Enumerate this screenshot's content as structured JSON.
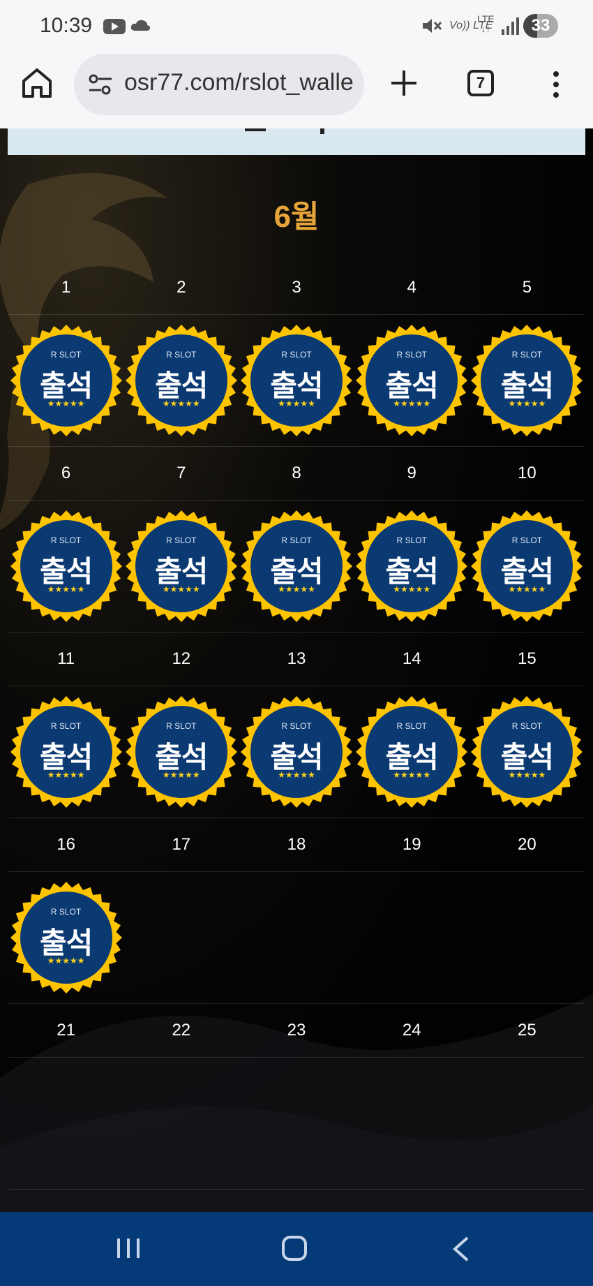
{
  "status_bar": {
    "time": "10:39",
    "icons": [
      "youtube-icon",
      "cloud-icon",
      "mute-icon",
      "volte-icon",
      "lte-icon",
      "signal-icon"
    ],
    "volte": "Vo)) LTE",
    "lte_top": "LTE",
    "lte_bottom": "↓↑",
    "battery": "33"
  },
  "browser": {
    "url": "osr77.com/rslot_walle",
    "tab_count": "7"
  },
  "page": {
    "month_title": "6월",
    "stamp": {
      "brand": "R SLOT",
      "word": "출석",
      "stars": "★★★★★"
    },
    "calendar_rows": [
      {
        "days": [
          "1",
          "2",
          "3",
          "4",
          "5"
        ],
        "stamped": [
          true,
          true,
          true,
          true,
          true
        ]
      },
      {
        "days": [
          "6",
          "7",
          "8",
          "9",
          "10"
        ],
        "stamped": [
          true,
          true,
          true,
          true,
          true
        ]
      },
      {
        "days": [
          "11",
          "12",
          "13",
          "14",
          "15"
        ],
        "stamped": [
          true,
          true,
          true,
          true,
          true
        ]
      },
      {
        "days": [
          "16",
          "17",
          "18",
          "19",
          "20"
        ],
        "stamped": [
          true,
          false,
          false,
          false,
          false
        ]
      },
      {
        "days": [
          "21",
          "22",
          "23",
          "24",
          "25"
        ],
        "stamped": [
          false,
          false,
          false,
          false,
          false
        ]
      }
    ]
  },
  "colors": {
    "month_title": "#e7a43a",
    "stamp_blue": "#0b3a73",
    "stamp_gold": "#ffd21a",
    "chat_button": "#7b5cf0",
    "nav_bar": "#053a78"
  }
}
